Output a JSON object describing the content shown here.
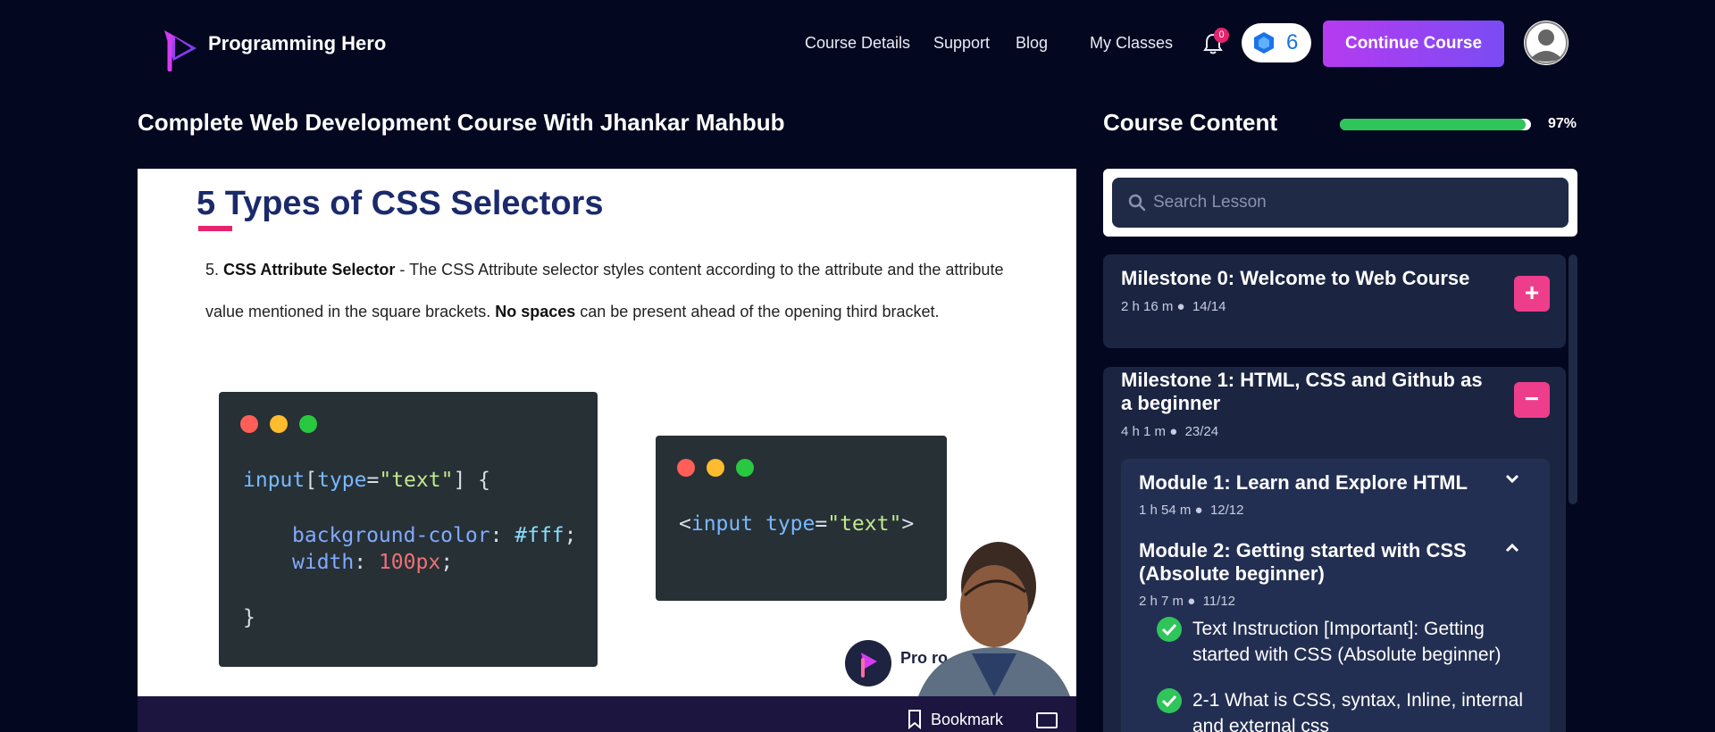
{
  "header": {
    "brand": "Programming Hero",
    "nav": [
      "Course Details",
      "Support",
      "Blog",
      "My Classes"
    ],
    "notification_count": "0",
    "gem_count": "6",
    "continue_label": "Continue Course"
  },
  "page": {
    "title": "Complete Web Development Course With Jhankar Mahbub"
  },
  "video": {
    "slide_title": "5 Types of CSS Selectors",
    "item_number": "5.",
    "item_heading": "CSS Attribute Selector",
    "item_text_1": " - The CSS Attribute selector styles content according to the attribute and the attribute value mentioned in the square brackets. ",
    "item_bold_2": "No spaces",
    "item_text_2": " can be present ahead of the opening third bracket.",
    "code1": {
      "selector": "input",
      "attr": "type",
      "str": "\"text\"",
      "prop1": "background-color",
      "val1": "#fff",
      "prop2": "width",
      "num2": "100",
      "unit2": "px"
    },
    "code2": {
      "tag": "input",
      "attr": "type",
      "str": "\"text\""
    },
    "watermark": "Pro        ro",
    "bookmark_label": "Bookmark"
  },
  "sidebar": {
    "title": "Course Content",
    "progress_percent": 97,
    "progress_label": "97%",
    "search_placeholder": "Search Lesson",
    "milestones": [
      {
        "title": "Milestone 0: Welcome to Web Course",
        "duration": "2 h 16 m",
        "count": "14/14",
        "button": "+"
      },
      {
        "title": "Milestone 1: HTML, CSS and Github as a beginner",
        "duration": "4 h 1 m",
        "count": "23/24",
        "button": "−"
      }
    ],
    "modules": [
      {
        "title": "Module 1: Learn and Explore HTML",
        "duration": "1 h 54 m",
        "count": "12/12"
      },
      {
        "title": "Module 2: Getting started with CSS (Absolute beginner)",
        "duration": "2 h 7 m",
        "count": "11/12"
      }
    ],
    "lessons": [
      "Text Instruction [Important]: Getting started with CSS (Absolute beginner)",
      "2-1 What is CSS, syntax, Inline, internal and external css"
    ]
  },
  "colors": {
    "background": "#030720",
    "accent_pink": "#ee3e8b",
    "progress_green": "#2fc55a",
    "button_gradient_start": "#b63bf0",
    "button_gradient_end": "#7a4cf3"
  }
}
